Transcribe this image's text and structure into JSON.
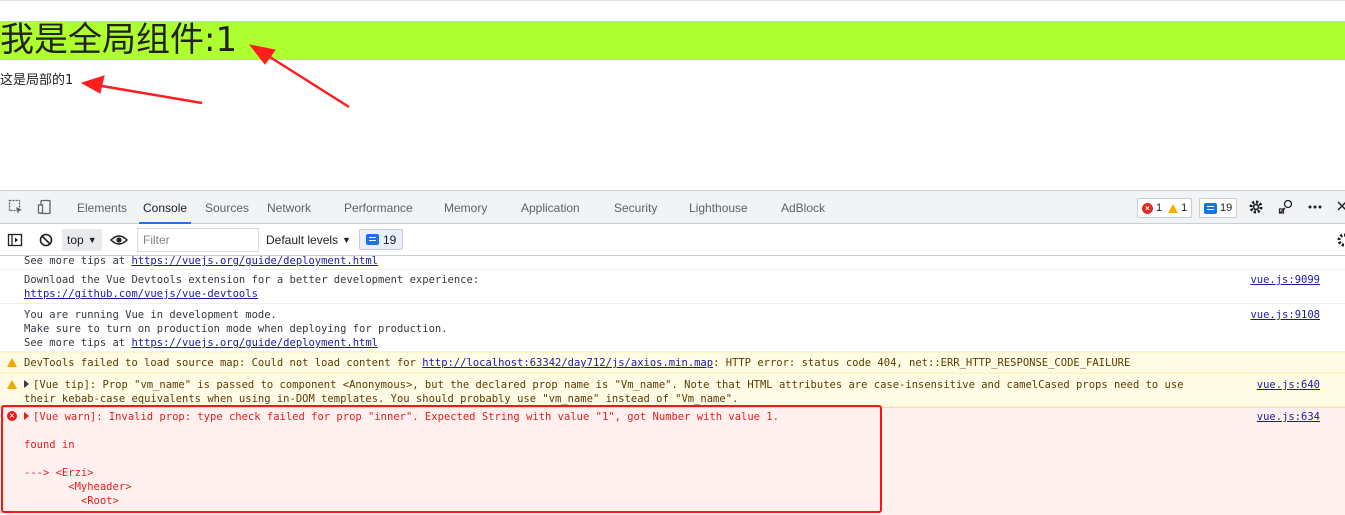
{
  "page": {
    "global_component_text": "我是全局组件:1",
    "local_component_text": "这是局部的1",
    "global_bar_color": "#adff2f",
    "annotation_color": "#ff1e1e"
  },
  "devtools": {
    "tabs": [
      "Elements",
      "Console",
      "Sources",
      "Network",
      "Performance",
      "Memory",
      "Application",
      "Security",
      "Lighthouse",
      "AdBlock"
    ],
    "active_tab": "Console",
    "issues": {
      "errors": "1",
      "warnings": "1",
      "messages": "19"
    },
    "toolbar": {
      "context": "top",
      "filter_placeholder": "Filter",
      "levels": "Default levels",
      "message_count": "19"
    },
    "console": {
      "entry0": {
        "prefix": "See more tips at ",
        "link": "https://vuejs.org/guide/deployment.html"
      },
      "entry1": {
        "line1": "Download the Vue Devtools extension for a better development experience:",
        "link": "https://github.com/vuejs/vue-devtools",
        "source": "vue.js:9099"
      },
      "entry2": {
        "line1": "You are running Vue in development mode.",
        "line2": "Make sure to turn on production mode when deploying for production.",
        "prefix": "See more tips at ",
        "link": "https://vuejs.org/guide/deployment.html",
        "source": "vue.js:9108"
      },
      "entry3": {
        "prefix": "DevTools failed to load source map: Could not load content for ",
        "link": "http://localhost:63342/day712/js/axios.min.map",
        "suffix": ": HTTP error: status code 404, net::ERR_HTTP_RESPONSE_CODE_FAILURE"
      },
      "entry4": {
        "line1": "[Vue tip]: Prop \"vm_name\" is passed to component <Anonymous>, but the declared prop name is \"Vm_name\". Note that HTML attributes are case-insensitive and camelCased props need to use",
        "line2": "their kebab-case equivalents when using in-DOM templates. You should probably use \"vm_name\" instead of \"Vm_name\".",
        "source": "vue.js:640"
      },
      "entry5": {
        "line1": "[Vue warn]: Invalid prop: type check failed for prop \"inner\". Expected String with value \"1\", got Number with value 1.",
        "line2": "found in",
        "line3": "---> <Erzi>",
        "line4": "       <Myheader>",
        "line5": "         <Root>",
        "source": "vue.js:634"
      }
    }
  }
}
